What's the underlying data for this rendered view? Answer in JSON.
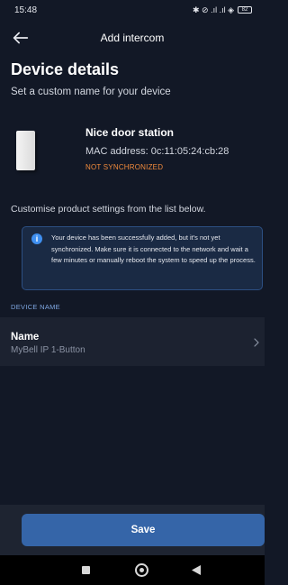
{
  "status_bar": {
    "time": "15:48",
    "icons_text": "✱ ⊘ .ıl .ıl ◈",
    "battery": "82"
  },
  "header": {
    "title": "Add intercom",
    "back_icon": "arrow-left-icon"
  },
  "section": {
    "title": "Device details",
    "subtitle": "Set a custom name for your device"
  },
  "device": {
    "name": "Nice door station",
    "mac": "MAC address: 0c:11:05:24:cb:28",
    "status": "NOT SYNCHRONIZED",
    "status_color": "#f08a3c"
  },
  "customise_text": "Customise product settings from the list below.",
  "info": {
    "icon": "info-icon",
    "text": "Your device has been successfully added, but it's not yet synchronized. Make sure it is connected to the network and wait a few minutes or manually reboot the system to speed up the process."
  },
  "device_name_section": {
    "header": "DEVICE NAME",
    "label": "Name",
    "value": "MyBell IP 1-Button"
  },
  "footer": {
    "save_label": "Save",
    "accent": "#3565a8"
  }
}
